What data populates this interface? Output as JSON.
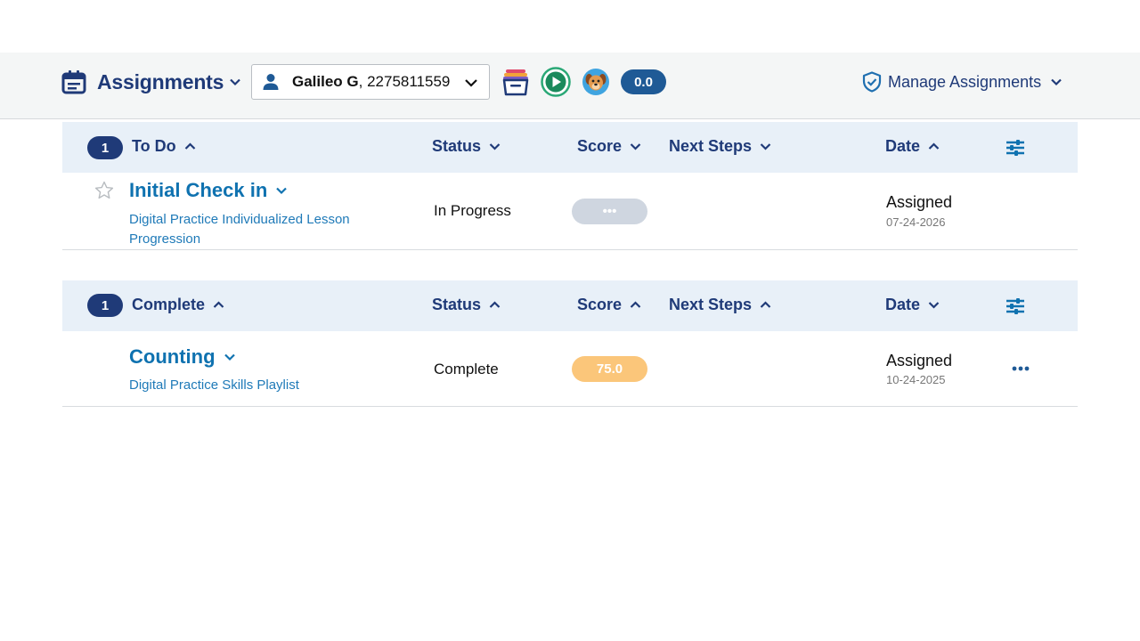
{
  "header": {
    "app_title": "Assignments",
    "student_name": "Galileo G",
    "student_id": ", 2275811559",
    "points": "0.0",
    "manage_label": "Manage Assignments",
    "icons": [
      "calendar-icon",
      "basket-icon",
      "play-icon",
      "pet-icon",
      "shield-icon"
    ]
  },
  "sections": {
    "todo": {
      "count": "1",
      "label": "To Do",
      "col_status": "Status",
      "col_score": "Score",
      "col_next": "Next Steps",
      "col_date": "Date",
      "rows": [
        {
          "title": "Initial Check in",
          "subtitle": "Digital Practice Individualized Lesson Progression",
          "status": "In Progress",
          "score": "•••",
          "date_label": "Assigned",
          "date": "07-24-2026"
        }
      ]
    },
    "complete": {
      "count": "1",
      "label": "Complete",
      "col_status": "Status",
      "col_score": "Score",
      "col_next": "Next Steps",
      "col_date": "Date",
      "rows": [
        {
          "title": "Counting",
          "subtitle": "Digital Practice Skills Playlist",
          "status": "Complete",
          "score": "75.0",
          "date_label": "Assigned",
          "date": "10-24-2025"
        }
      ]
    }
  },
  "colors": {
    "navy": "#1f3a78",
    "link_blue": "#0f72b0",
    "header_bg": "#e8f0f8",
    "score_pending": "#cfd6e0",
    "score_complete": "#fbc67a",
    "points_pill": "#1f5a96"
  }
}
